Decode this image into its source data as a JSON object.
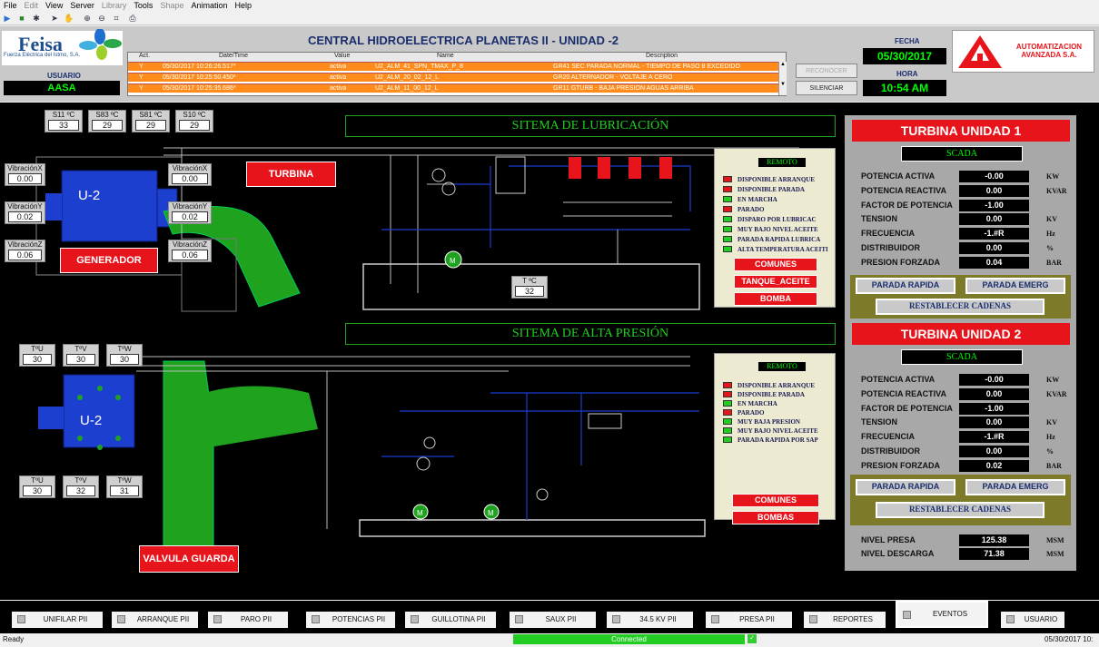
{
  "menu": [
    "File",
    "Edit",
    "View",
    "Server",
    "Library",
    "Tools",
    "Shape",
    "Animation",
    "Help"
  ],
  "menu_disabled": [
    false,
    true,
    false,
    false,
    true,
    false,
    true,
    false,
    false
  ],
  "header": {
    "logo_name": "Feisa",
    "logo_sub": "Fuerza Eléctrica del Istmo, S.A.",
    "usuario_label": "USUARIO",
    "usuario_value": "AASA",
    "title": "CENTRAL HIDROELECTRICA PLANETAS II  -  UNIDAD  -2",
    "fecha_label": "FECHA",
    "fecha_value": "05/30/2017",
    "hora_label": "HORA",
    "hora_value": "10:54 AM",
    "company": "AUTOMATIZACION AVANZADA S.A.",
    "reconocer": "RECONOCER",
    "silenciar": "SILENCIAR"
  },
  "alarms": {
    "columns": [
      "Act.",
      "Date/Time",
      "Value",
      "Name",
      "Description"
    ],
    "rows": [
      {
        "act": "Y",
        "dt": "05/30/2017 10:26:26.517*",
        "val": "activa",
        "name": "U2_ALM_41_SPN_TMAX_P_8",
        "desc": "GR41 SEC PARADA NORMAL - TIEMPO DE PASO 8 EXCEDIDO"
      },
      {
        "act": "Y",
        "dt": "05/30/2017 10:25:50.450*",
        "val": "activa",
        "name": "U2_ALM_20_02_12_L",
        "desc": "GR20 ALTERNADOR - VOLTAJE A CERO"
      },
      {
        "act": "Y",
        "dt": "05/30/2017 10:25:35.686*",
        "val": "activa",
        "name": "U2_ALM_11_00_12_L",
        "desc": "GR11 GTURB - BAJA PRESION AGUAS ARRIBA"
      }
    ]
  },
  "gen": {
    "temps": [
      {
        "label": "S11 ºC",
        "value": "33"
      },
      {
        "label": "S83 ºC",
        "value": "29"
      },
      {
        "label": "S81 ºC",
        "value": "29"
      },
      {
        "label": "S10 ºC",
        "value": "29"
      }
    ],
    "vib_left": [
      {
        "label": "VibraciónX",
        "value": "0.00"
      },
      {
        "label": "VibraciónY",
        "value": "0.02"
      },
      {
        "label": "VibraciónZ",
        "value": "0.06"
      }
    ],
    "vib_right": [
      {
        "label": "VibraciónX",
        "value": "0.00"
      },
      {
        "label": "VibraciónY",
        "value": "0.02"
      },
      {
        "label": "VibraciónZ",
        "value": "0.06"
      }
    ],
    "unit_label": "U-2",
    "turbina_btn": "TURBINA",
    "generador_btn": "GENERADOR"
  },
  "lub": {
    "title": "SITEMA DE  LUBRICACIÓN",
    "tank_label": "T ºC",
    "tank_value": "32",
    "remoto": "REMOTO",
    "items": [
      {
        "label": "DISPONIBLE ARRANQUE",
        "color": "#e8141b"
      },
      {
        "label": "DISPONIBLE PARADA",
        "color": "#e8141b"
      },
      {
        "label": "EN MARCHA",
        "color": "#1fd01f"
      },
      {
        "label": "PARADO",
        "color": "#e8141b"
      },
      {
        "label": "DISPARO POR LUBRICAC",
        "color": "#1fd01f"
      },
      {
        "label": "MUY BAJO NIVEL ACEITE",
        "color": "#1fd01f"
      },
      {
        "label": "PARADA RAPIDA  LUBRICA",
        "color": "#1fd01f"
      },
      {
        "label": "ALTA TEMPERATURA ACEITI",
        "color": "#1fd01f"
      }
    ],
    "buttons": [
      "COMUNES",
      "TANQUE_ACEITE",
      "BOMBA"
    ]
  },
  "hp": {
    "title": "SITEMA DE ALTA PRESIÓN",
    "temps_top": [
      {
        "label": "TºU",
        "value": "30"
      },
      {
        "label": "TºV",
        "value": "30"
      },
      {
        "label": "TºW",
        "value": "30"
      }
    ],
    "temps_bottom": [
      {
        "label": "TºU",
        "value": "30"
      },
      {
        "label": "TºV",
        "value": "32"
      },
      {
        "label": "TºW",
        "value": "31"
      }
    ],
    "unit_label": "U-2",
    "valvula_btn": "VALVULA GUARDA",
    "remoto": "REMOTO",
    "items": [
      {
        "label": "DISPONIBLE ARRANQUE",
        "color": "#e8141b"
      },
      {
        "label": "DISPONIBLE PARADA",
        "color": "#e8141b"
      },
      {
        "label": "EN MARCHA",
        "color": "#1fd01f"
      },
      {
        "label": "PARADO",
        "color": "#e8141b"
      },
      {
        "label": "MUY BAJA PRESION",
        "color": "#1fd01f"
      },
      {
        "label": "MUY BAJO NIVEL ACEITE",
        "color": "#1fd01f"
      },
      {
        "label": "PARADA RAPIDA POR SAP",
        "color": "#1fd01f"
      }
    ],
    "buttons": [
      "COMUNES",
      "BOMBAS"
    ]
  },
  "turbine1": {
    "title": "TURBINA UNIDAD 1",
    "scada": "SCADA",
    "rows": [
      {
        "label": "POTENCIA ACTIVA",
        "value": "-0.00",
        "unit": "KW"
      },
      {
        "label": "POTENCIA REACTIVA",
        "value": "0.00",
        "unit": "KVAR"
      },
      {
        "label": "FACTOR DE POTENCIA",
        "value": "-1.00",
        "unit": ""
      },
      {
        "label": "TENSION",
        "value": "0.00",
        "unit": "KV"
      },
      {
        "label": "FRECUENCIA",
        "value": "-1.#R",
        "unit": "Hz"
      },
      {
        "label": "DISTRIBUIDOR",
        "value": "0.00",
        "unit": "%"
      },
      {
        "label": "PRESION FORZADA",
        "value": "0.04",
        "unit": "BAR"
      }
    ],
    "parada_rapida": "PARADA RAPIDA",
    "parada_emerg": "PARADA EMERG",
    "restablecer": "RESTABLECER CADENAS"
  },
  "turbine2": {
    "title": "TURBINA UNIDAD 2",
    "scada": "SCADA",
    "rows": [
      {
        "label": "POTENCIA ACTIVA",
        "value": "-0.00",
        "unit": "KW"
      },
      {
        "label": "POTENCIA REACTIVA",
        "value": "0.00",
        "unit": "KVAR"
      },
      {
        "label": "FACTOR DE POTENCIA",
        "value": "-1.00",
        "unit": ""
      },
      {
        "label": "TENSION",
        "value": "0.00",
        "unit": "KV"
      },
      {
        "label": "FRECUENCIA",
        "value": "-1.#R",
        "unit": "Hz"
      },
      {
        "label": "DISTRIBUIDOR",
        "value": "0.00",
        "unit": "%"
      },
      {
        "label": "PRESION FORZADA",
        "value": "0.02",
        "unit": "BAR"
      }
    ],
    "parada_rapida": "PARADA RAPIDA",
    "parada_emerg": "PARADA EMERG",
    "restablecer": "RESTABLECER CADENAS"
  },
  "levels": [
    {
      "label": "NIVEL PRESA",
      "value": "125.38",
      "unit": "MSM"
    },
    {
      "label": "NIVEL DESCARGA",
      "value": "71.38",
      "unit": "MSM"
    }
  ],
  "nav": [
    "UNIFILAR PII",
    "ARRANQUE PII",
    "PARO PII",
    "POTENCIAS PII",
    "GUILLOTINA PII",
    "SAUX PII",
    "34.5 KV PII",
    "PRESA PII",
    "REPORTES",
    "EVENTOS",
    "USUARIO"
  ],
  "status": {
    "ready": "Ready",
    "connected": "Connected",
    "datetime": "05/30/2017 10:"
  }
}
